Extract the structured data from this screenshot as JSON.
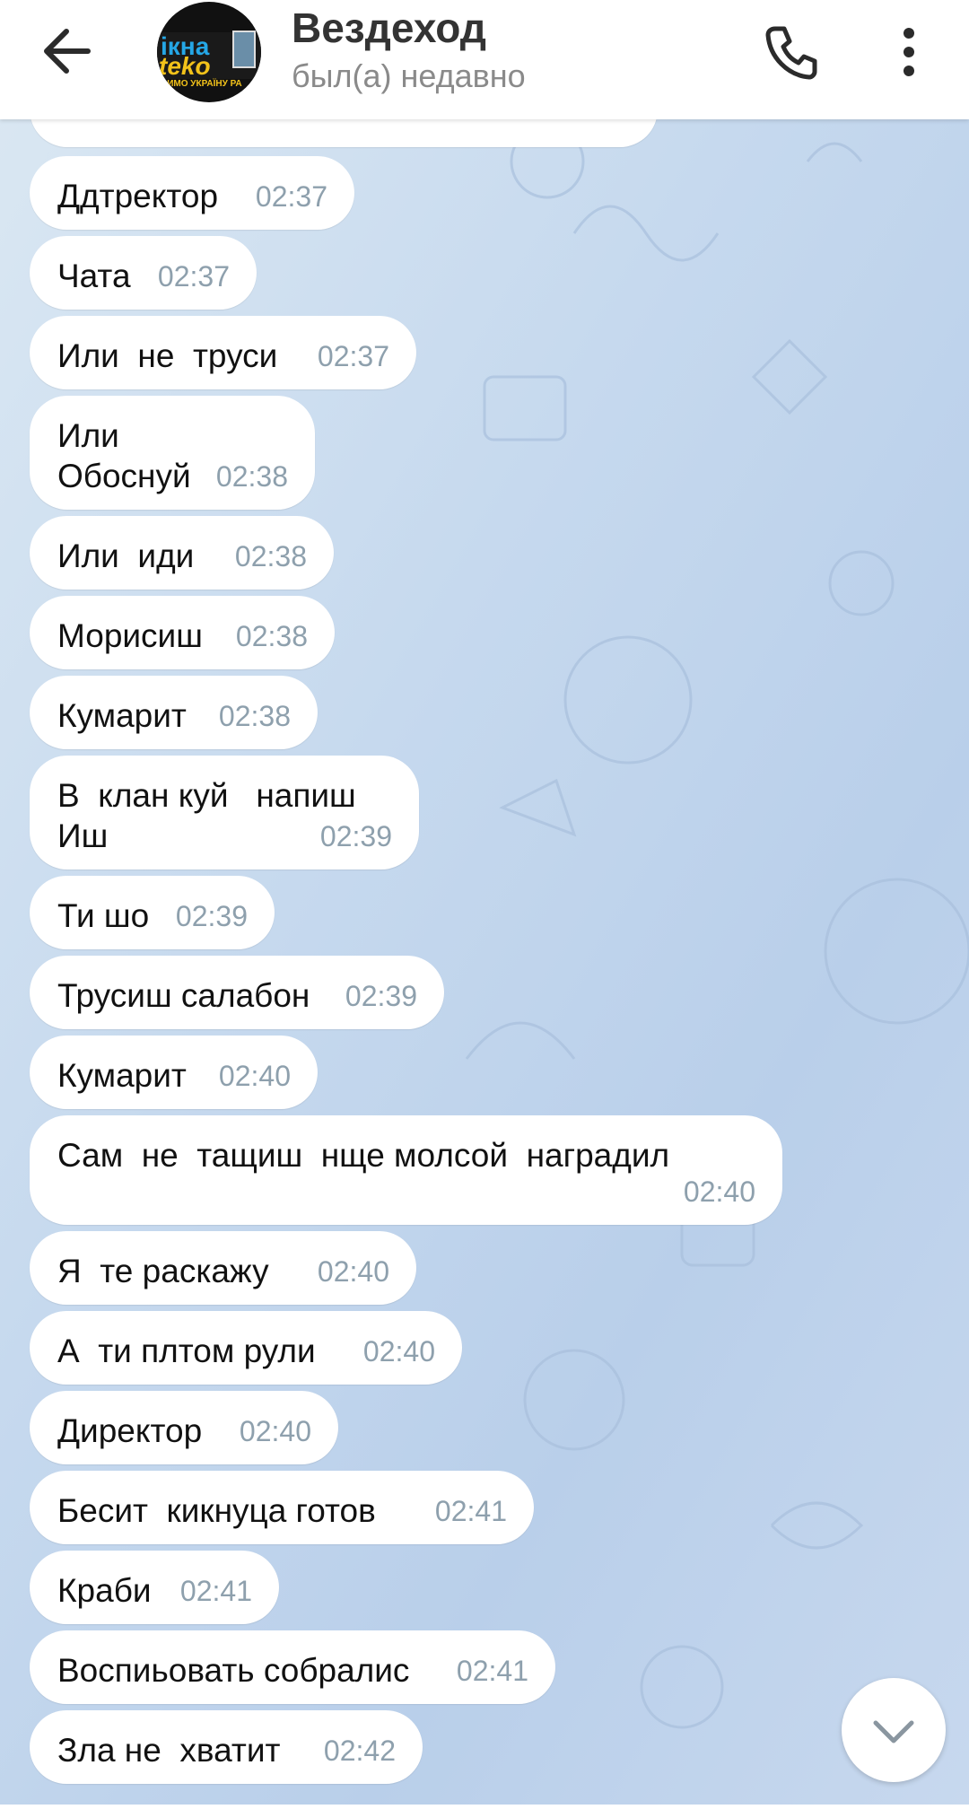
{
  "header": {
    "title": "Вездеход",
    "status": "был(а) недавно",
    "avatar_text": [
      "ікна",
      "teko",
      "ВИМО УКРАЇНУ РА"
    ]
  },
  "messages": [
    {
      "text": "Ддтректор",
      "time": "02:37"
    },
    {
      "text": "Чата",
      "time": "02:37"
    },
    {
      "text": "Или  не  труси",
      "time": "02:37"
    },
    {
      "text": "Или\nОбоснуй",
      "time": "02:38"
    },
    {
      "text": "Или  иди",
      "time": "02:38"
    },
    {
      "text": "Морисиш",
      "time": "02:38"
    },
    {
      "text": "Кумарит",
      "time": "02:38"
    },
    {
      "text": "В  клан куй   напиш\nИш",
      "time": "02:39"
    },
    {
      "text": "Ти шо",
      "time": "02:39"
    },
    {
      "text": "Трусиш салабон",
      "time": "02:39"
    },
    {
      "text": "Кумарит",
      "time": "02:40"
    },
    {
      "text": "Сам  не  тащиш  нще молсой  наградил",
      "time": "02:40"
    },
    {
      "text": "Я  те раскажу",
      "time": "02:40"
    },
    {
      "text": "А  ти плтом рули",
      "time": "02:40"
    },
    {
      "text": "Директор",
      "time": "02:40"
    },
    {
      "text": "Бесит  кикнуца готов",
      "time": "02:41"
    },
    {
      "text": "Краби",
      "time": "02:41"
    },
    {
      "text": "Воспиьовать собралис",
      "time": "02:41"
    },
    {
      "text": "Зла не  хватит",
      "time": "02:42"
    }
  ],
  "icons": {
    "back": "arrow-left-icon",
    "call": "phone-icon",
    "menu": "more-vertical-icon",
    "scroll": "chevron-down-icon"
  },
  "colors": {
    "header_bg": "#ffffff",
    "bubble_bg": "#ffffff",
    "time_text": "#8ea0ad",
    "chat_bg": "#c6d9ee"
  }
}
